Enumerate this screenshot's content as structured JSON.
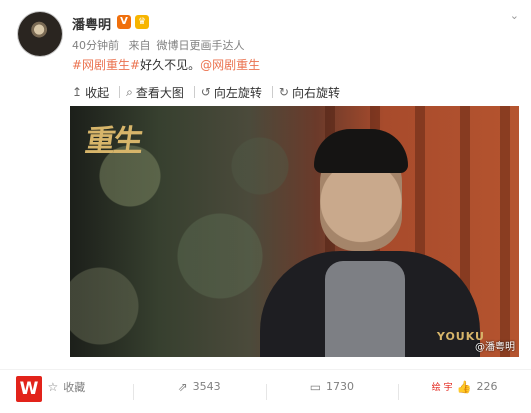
{
  "post": {
    "author": "潘粤明",
    "verified_badge": "V",
    "level_badge": "♛",
    "time": "40分钟前",
    "source_prefix": "来自",
    "source": "微博日更画手达人",
    "content": {
      "hashtag": "#网剧重生#",
      "text": "好久不见。",
      "mention": "@网剧重生"
    }
  },
  "image_toolbar": {
    "items": [
      {
        "icon": "arrow-up-icon",
        "glyph": "↥",
        "label": "收起"
      },
      {
        "icon": "magnify-icon",
        "glyph": "⌕",
        "label": "查看大图"
      },
      {
        "icon": "rotate-left-icon",
        "glyph": "↺",
        "label": "向左旋转"
      },
      {
        "icon": "rotate-right-icon",
        "glyph": "↻",
        "label": "向右旋转"
      }
    ]
  },
  "image": {
    "title_art": "重生",
    "logo_text": "YOUKU",
    "watermark": "@潘粤明"
  },
  "footer": {
    "brand": "W",
    "favorite": {
      "icon": "star-icon",
      "glyph": "☆",
      "label": "收藏"
    },
    "repost": {
      "icon": "repost-icon",
      "glyph": "⇗",
      "label": "3543"
    },
    "comment": {
      "icon": "comment-icon",
      "glyph": "▭",
      "label": "1730"
    },
    "like": {
      "icon": "thumb-up-icon",
      "glyph": "👍",
      "label": "226"
    },
    "watermark_small": "绘 宇"
  },
  "colors": {
    "accent": "#eb7350",
    "brand": "#e2231a",
    "verified": "#f06f0c"
  }
}
